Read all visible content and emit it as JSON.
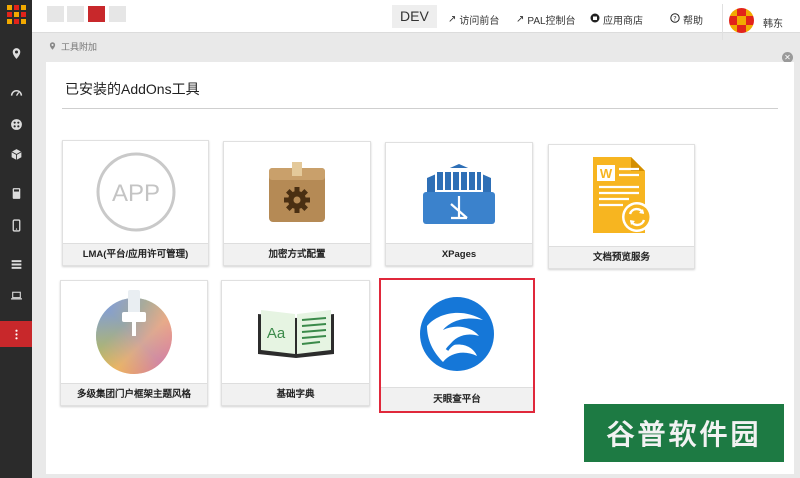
{
  "topbar": {
    "env_label": "DEV",
    "links": [
      {
        "label": "访问前台",
        "icon": "external-link-icon"
      },
      {
        "label": "PAL控制台",
        "icon": "external-link-icon"
      },
      {
        "label": "应用商店",
        "icon": "store-icon"
      },
      {
        "label": "帮助",
        "icon": "help-icon"
      }
    ],
    "user_name": "韩东"
  },
  "breadcrumb": {
    "label": "工具附加"
  },
  "panel": {
    "title": "已安装的AddOns工具",
    "tools": [
      {
        "label": "LMA(平台/应用许可管理)",
        "icon": "app-circle-icon",
        "icon_text": "APP"
      },
      {
        "label": "加密方式配置",
        "icon": "gear-box-icon"
      },
      {
        "label": "XPages",
        "icon": "xpages-icon"
      },
      {
        "label": "文档预览服务",
        "icon": "word-sync-icon",
        "icon_text": "W"
      },
      {
        "label": "多级集团门户框架主题风格",
        "icon": "color-wheel-brush-icon"
      },
      {
        "label": "基础字典",
        "icon": "dictionary-book-icon",
        "icon_text": "Aa"
      },
      {
        "label": "天眼查平台",
        "icon": "tianyancha-logo-icon"
      }
    ]
  },
  "watermark": {
    "text": "谷普软件园"
  },
  "colors": {
    "accent_red": "#c8282b",
    "selected_border": "#e0283b",
    "sidebar_bg": "#2b2b2b",
    "watermark_bg": "#1d7a43"
  }
}
